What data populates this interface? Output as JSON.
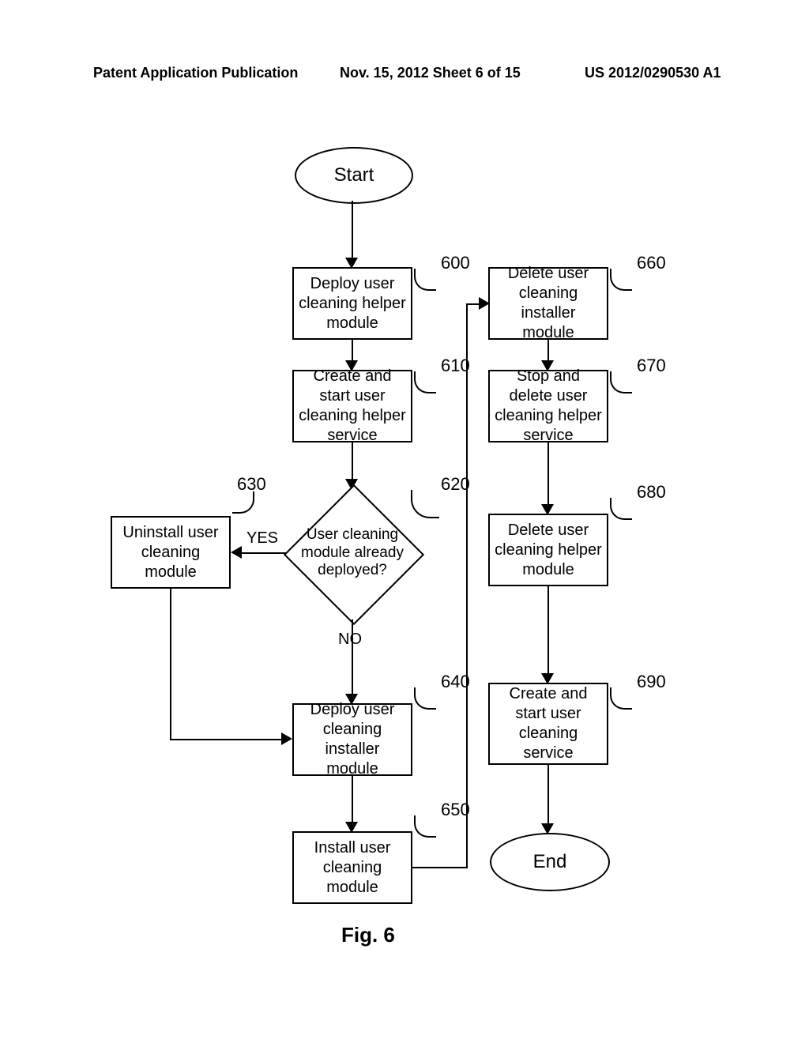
{
  "header": {
    "left": "Patent Application Publication",
    "center": "Nov. 15, 2012  Sheet 6 of 15",
    "right": "US 2012/0290530 A1"
  },
  "flow": {
    "start": "Start",
    "end": "End",
    "step600": "Deploy user cleaning helper module",
    "step610": "Create and start user cleaning helper service",
    "decision620": "User cleaning module already deployed?",
    "step630": "Uninstall user cleaning module",
    "step640": "Deploy user cleaning installer module",
    "step650": "Install user cleaning module",
    "step660": "Delete user cleaning installer module",
    "step670": "Stop and delete user cleaning helper service",
    "step680": "Delete user cleaning helper module",
    "step690": "Create and start user cleaning service",
    "yes": "YES",
    "no": "NO"
  },
  "refs": {
    "r600": "600",
    "r610": "610",
    "r620": "620",
    "r630": "630",
    "r640": "640",
    "r650": "650",
    "r660": "660",
    "r670": "670",
    "r680": "680",
    "r690": "690"
  },
  "caption": "Fig. 6"
}
